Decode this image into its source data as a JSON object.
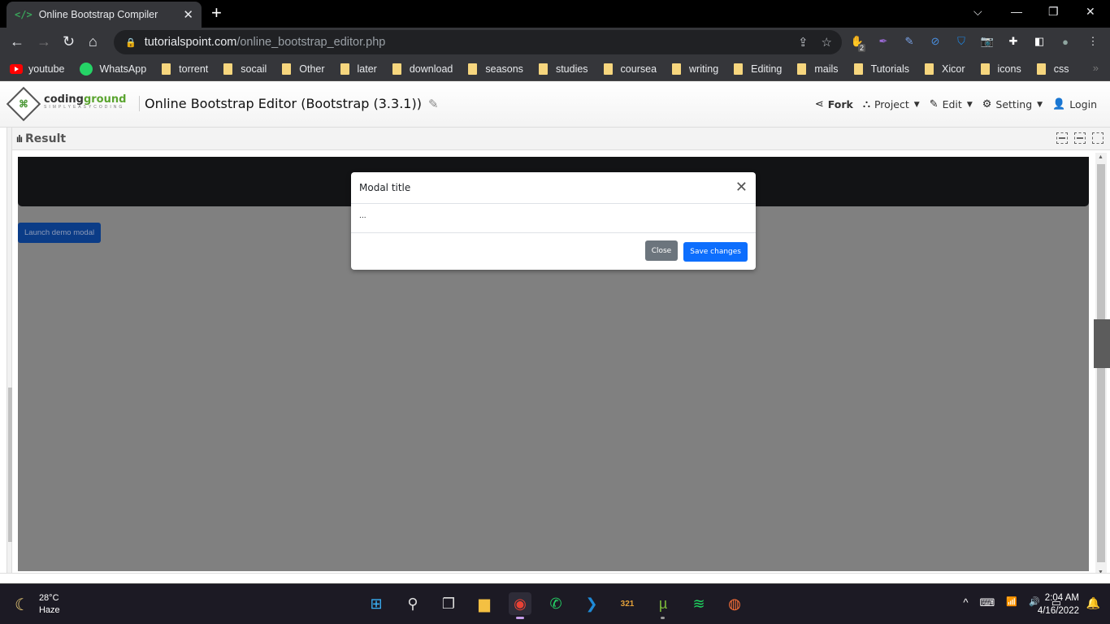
{
  "browser": {
    "tab": {
      "title": "Online Bootstrap Compiler",
      "favicon": "</>",
      "close": "✕"
    },
    "new_tab": "+",
    "window_controls": {
      "dropdown": "⌵",
      "minimize": "—",
      "restore": "❐",
      "close": "✕"
    },
    "nav": {
      "back": "←",
      "forward": "→",
      "reload": "↻",
      "home": "⌂"
    },
    "address": {
      "lock": "🔒",
      "domain": "tutorialspoint.com",
      "path": "/online_bootstrap_editor.php"
    },
    "address_icons": {
      "share": "⇪",
      "bookmark": "☆"
    },
    "extensions": [
      {
        "name": "adblock",
        "glyph": "✋",
        "color": "#e11",
        "badge": "2"
      },
      {
        "name": "feather",
        "glyph": "✒",
        "color": "#9b6ad6"
      },
      {
        "name": "pen",
        "glyph": "✎",
        "color": "#7aa3e8"
      },
      {
        "name": "block",
        "glyph": "⊘",
        "color": "#4a90e2"
      },
      {
        "name": "vpn-shield",
        "glyph": "⛉",
        "color": "#1e88e5"
      },
      {
        "name": "camera",
        "glyph": "📷",
        "color": "#aaa"
      },
      {
        "name": "puzzle",
        "glyph": "✚",
        "color": "#fff"
      },
      {
        "name": "sidepanel",
        "glyph": "◧",
        "color": "#fff"
      },
      {
        "name": "profile",
        "glyph": "●",
        "color": "#8fa6a0"
      },
      {
        "name": "menu",
        "glyph": "⋮",
        "color": "#e8eaed"
      }
    ],
    "bookmarks": [
      {
        "label": "youtube",
        "type": "youtube"
      },
      {
        "label": "WhatsApp",
        "type": "whatsapp"
      },
      {
        "label": "torrent",
        "type": "folder"
      },
      {
        "label": "socail",
        "type": "folder"
      },
      {
        "label": "Other",
        "type": "folder"
      },
      {
        "label": "later",
        "type": "folder"
      },
      {
        "label": "download",
        "type": "folder"
      },
      {
        "label": "seasons",
        "type": "folder"
      },
      {
        "label": "studies",
        "type": "folder"
      },
      {
        "label": "coursea",
        "type": "folder"
      },
      {
        "label": "writing",
        "type": "folder"
      },
      {
        "label": "Editing",
        "type": "folder"
      },
      {
        "label": "mails",
        "type": "folder"
      },
      {
        "label": "Tutorials",
        "type": "folder"
      },
      {
        "label": "Xicor",
        "type": "folder"
      },
      {
        "label": "icons",
        "type": "folder"
      },
      {
        "label": "css",
        "type": "folder"
      }
    ],
    "bookmarks_more": "»"
  },
  "site": {
    "logo": {
      "brand_a": "coding",
      "brand_b": "ground",
      "tagline": "SIMPLYEASYCODING"
    },
    "title": "Online Bootstrap Editor (Bootstrap (3.3.1))",
    "nav": [
      {
        "label": "Fork",
        "icon": "⋖",
        "caret": false
      },
      {
        "label": "Project",
        "icon": "⛬",
        "caret": true
      },
      {
        "label": "Edit",
        "icon": "✎",
        "caret": true
      },
      {
        "label": "Setting",
        "icon": "⚙",
        "caret": true
      },
      {
        "label": "Login",
        "icon": "👤",
        "caret": false
      }
    ],
    "caret": "▼",
    "result_label": "Result",
    "result_icon": "ılı"
  },
  "preview": {
    "launch_button": "Launch demo modal",
    "modal": {
      "title": "Modal title",
      "close_icon": "✕",
      "body": "...",
      "close_button": "Close",
      "save_button": "Save changes"
    }
  },
  "taskbar": {
    "weather": {
      "temp": "28°C",
      "condition": "Haze",
      "icon": "☾"
    },
    "apps": [
      {
        "name": "start",
        "glyph": "⊞",
        "color": "#3ab0f5"
      },
      {
        "name": "search",
        "glyph": "⚲",
        "color": "#ddd"
      },
      {
        "name": "task-view",
        "glyph": "❐",
        "color": "#ddd"
      },
      {
        "name": "file-explorer",
        "glyph": "▆",
        "color": "#f4c042"
      },
      {
        "name": "chrome",
        "glyph": "◉",
        "color": "#e94235",
        "active": true
      },
      {
        "name": "whatsapp",
        "glyph": "✆",
        "color": "#25d366"
      },
      {
        "name": "vscode",
        "glyph": "❯",
        "color": "#1f8ad6"
      },
      {
        "name": "media-player",
        "glyph": "321",
        "color": "#e3a13a"
      },
      {
        "name": "utorrent",
        "glyph": "µ",
        "color": "#7cba3b",
        "running": true
      },
      {
        "name": "spotify",
        "glyph": "≋",
        "color": "#1ed760"
      },
      {
        "name": "firefox",
        "glyph": "◍",
        "color": "#ff7139"
      }
    ],
    "tray": {
      "chevron": "^",
      "keyboard": "⌨",
      "wifi": "📶",
      "volume": "🔊",
      "battery": "▭"
    },
    "time": "2:04 AM",
    "date": "4/16/2022",
    "notification": "🔔"
  }
}
